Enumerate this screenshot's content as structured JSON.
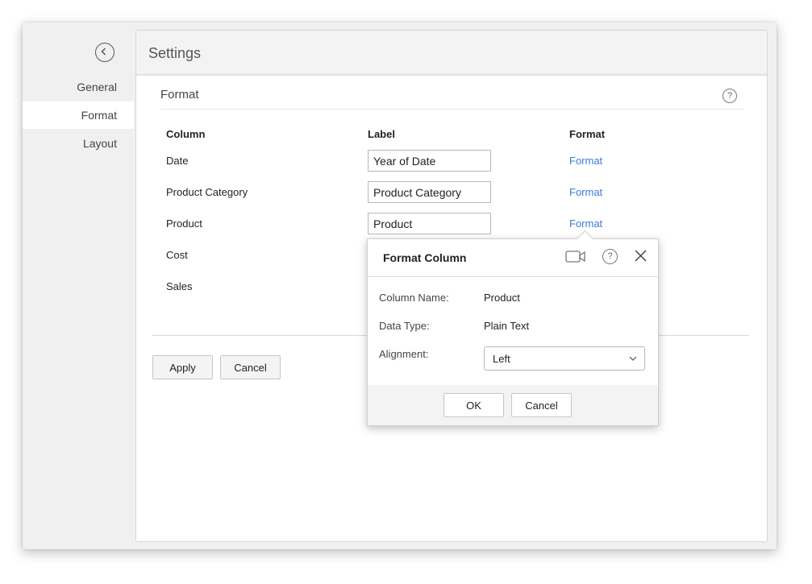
{
  "sidebar": {
    "back_icon": "chevron-left-circle-icon",
    "items": [
      {
        "label": "General",
        "active": false
      },
      {
        "label": "Format",
        "active": true
      },
      {
        "label": "Layout",
        "active": false
      }
    ]
  },
  "panel": {
    "title": "Settings",
    "section_title": "Format",
    "help_symbol": "?"
  },
  "table": {
    "headers": {
      "column": "Column",
      "label": "Label",
      "format": "Format"
    },
    "rows": [
      {
        "column": "Date",
        "label": "Year of Date",
        "format": "Format"
      },
      {
        "column": "Product Category",
        "label": "Product Category",
        "format": "Format"
      },
      {
        "column": "Product",
        "label": "Product",
        "format": "Format"
      },
      {
        "column": "Cost"
      },
      {
        "column": "Sales"
      }
    ]
  },
  "actions": {
    "apply": "Apply",
    "cancel": "Cancel"
  },
  "popup": {
    "title": "Format Column",
    "icons": [
      "video-icon",
      "help-icon",
      "close-icon"
    ],
    "help_symbol": "?",
    "fields": {
      "column_name_label": "Column Name:",
      "column_name_value": "Product",
      "data_type_label": "Data Type:",
      "data_type_value": "Plain Text",
      "alignment_label": "Alignment:",
      "alignment_value": "Left"
    },
    "ok": "OK",
    "cancel": "Cancel"
  },
  "colors": {
    "link": "#3b7bd6",
    "header_bg": "#f3f3f3",
    "sidebar_bg": "#f0f0f0"
  }
}
